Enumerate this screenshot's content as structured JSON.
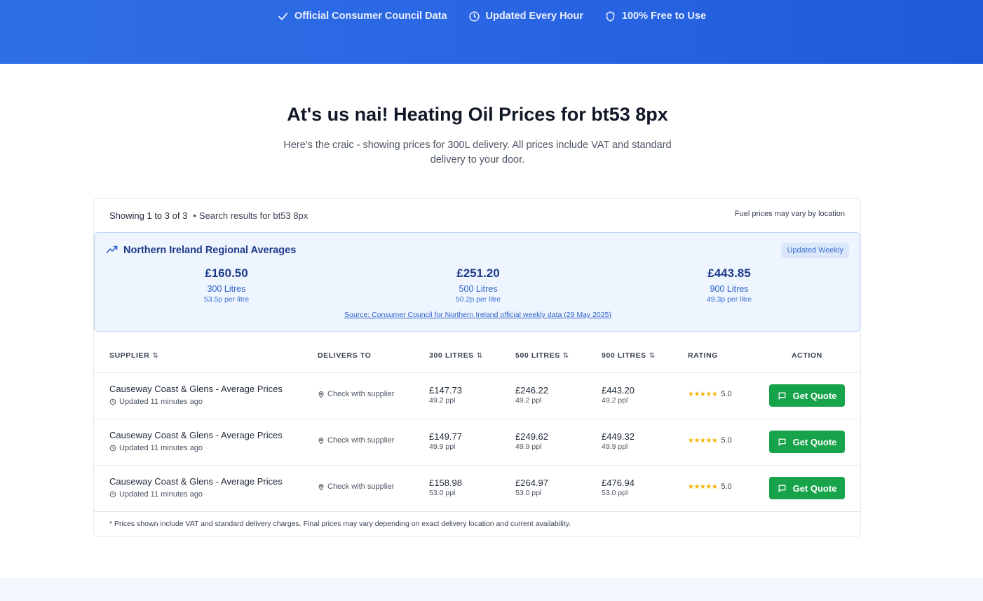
{
  "hero": {
    "badges": [
      {
        "icon": "check-icon",
        "label": "Official Consumer Council Data"
      },
      {
        "icon": "clock-icon",
        "label": "Updated Every Hour"
      },
      {
        "icon": "shield-icon",
        "label": "100% Free to Use"
      }
    ]
  },
  "heading": {
    "title": "At's us nai! Heating Oil Prices for bt53 8px",
    "subtitle": "Here's the craic - showing prices for 300L delivery. All prices include VAT and standard delivery to your door."
  },
  "results": {
    "showing": "Showing 1 to 3 of 3",
    "search": "Search results for bt53 8px",
    "vary_note": "Fuel prices may vary by location"
  },
  "regional": {
    "title": "Northern Ireland Regional Averages",
    "pill": "Updated Weekly",
    "averages": [
      {
        "price": "£160.50",
        "volume": "300 Litres",
        "ppl": "53.5p per litre"
      },
      {
        "price": "£251.20",
        "volume": "500 Litres",
        "ppl": "50.2p per litre"
      },
      {
        "price": "£443.85",
        "volume": "900 Litres",
        "ppl": "49.3p per litre"
      }
    ],
    "source": "Source: Consumer Council for Northern Ireland official weekly data (29 May 2025)"
  },
  "table": {
    "headers": {
      "supplier": "SUPPLIER",
      "delivers": "DELIVERS TO",
      "l300": "300 LITRES",
      "l500": "500 LITRES",
      "l900": "900 LITRES",
      "rating": "RATING",
      "action": "ACTION"
    },
    "rows": [
      {
        "supplier": "Causeway Coast & Glens - Average Prices",
        "updated": "Updated 11 minutes ago",
        "delivers": "Check with supplier",
        "p300": "£147.73",
        "ppl300": "49.2 ppl",
        "p500": "£246.22",
        "ppl500": "49.2 ppl",
        "p900": "£443.20",
        "ppl900": "49.2 ppl",
        "stars": "★★★★★",
        "rating": "5.0",
        "action": "Get Quote"
      },
      {
        "supplier": "Causeway Coast & Glens - Average Prices",
        "updated": "Updated 11 minutes ago",
        "delivers": "Check with supplier",
        "p300": "£149.77",
        "ppl300": "49.9 ppl",
        "p500": "£249.62",
        "ppl500": "49.9 ppl",
        "p900": "£449.32",
        "ppl900": "49.9 ppl",
        "stars": "★★★★★",
        "rating": "5.0",
        "action": "Get Quote"
      },
      {
        "supplier": "Causeway Coast & Glens - Average Prices",
        "updated": "Updated 11 minutes ago",
        "delivers": "Check with supplier",
        "p300": "£158.98",
        "ppl300": "53.0 ppl",
        "p500": "£264.97",
        "ppl500": "53.0 ppl",
        "p900": "£476.94",
        "ppl900": "53.0 ppl",
        "stars": "★★★★★",
        "rating": "5.0",
        "action": "Get Quote"
      }
    ],
    "footnote": "* Prices shown include VAT and standard delivery charges. Final prices may vary depending on exact delivery location and current availability."
  },
  "colors": {
    "hero_blue": "#2a66e3",
    "quote_green": "#16a34a",
    "regional_bg": "#eef5fe",
    "star_gold": "#f5b400"
  }
}
